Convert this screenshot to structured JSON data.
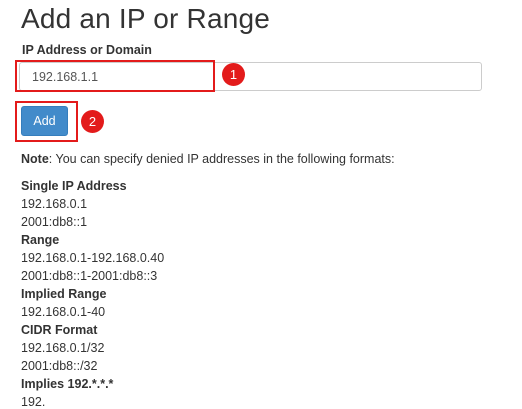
{
  "page": {
    "title": "Add an IP or Range"
  },
  "form": {
    "field_label": "IP Address or Domain",
    "ip_value": "192.168.1.1",
    "add_button_label": "Add"
  },
  "steps": {
    "step1": "1",
    "step2": "2"
  },
  "note": {
    "label": "Note",
    "text": ": You can specify denied IP addresses in the following formats:"
  },
  "formats": [
    {
      "heading": "Single IP Address",
      "examples": [
        "192.168.0.1",
        "2001:db8::1"
      ]
    },
    {
      "heading": "Range",
      "examples": [
        "192.168.0.1-192.168.0.40",
        "2001:db8::1-2001:db8::3"
      ]
    },
    {
      "heading": "Implied Range",
      "examples": [
        "192.168.0.1-40"
      ]
    },
    {
      "heading": "CIDR Format",
      "examples": [
        "192.168.0.1/32",
        "2001:db8::/32"
      ]
    },
    {
      "heading": "Implies 192.*.*.*",
      "examples": [
        "192."
      ]
    }
  ],
  "colors": {
    "primary_button": "#428bca",
    "highlight": "#e31b1b",
    "text": "#333333"
  }
}
